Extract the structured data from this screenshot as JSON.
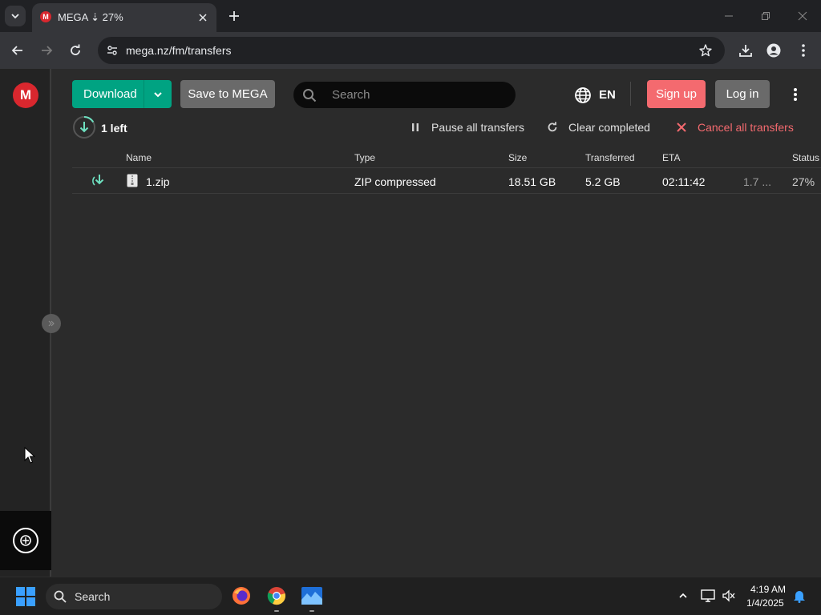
{
  "browser": {
    "tab_title": "MEGA ⇣ 27%",
    "favicon_letter": "M",
    "url": "mega.nz/fm/transfers"
  },
  "header": {
    "download_label": "Download",
    "save_to_mega_label": "Save to MEGA",
    "search_placeholder": "Search",
    "language": "EN",
    "signup_label": "Sign up",
    "login_label": "Log in",
    "logo_letter": "M"
  },
  "transfers": {
    "left_count": "1 left",
    "pause_all_label": "Pause all transfers",
    "clear_completed_label": "Clear completed",
    "cancel_all_label": "Cancel all transfers",
    "columns": {
      "name": "Name",
      "type": "Type",
      "size": "Size",
      "transferred": "Transferred",
      "eta": "ETA",
      "status": "Status"
    },
    "rows": [
      {
        "name": "1.zip",
        "type": "ZIP compressed",
        "size": "18.51 GB",
        "transferred": "5.2 GB",
        "eta": "02:11:42",
        "speed": "1.7 ...",
        "status": "27%"
      }
    ]
  },
  "taskbar": {
    "search_label": "Search",
    "time": "4:19 AM",
    "date": "1/4/2025"
  },
  "colors": {
    "download_green": "#00a382",
    "signup_red": "#f46a6f",
    "cancel_red": "#f46a6f",
    "mega_red": "#d9272e",
    "progress_teal": "#6ee0c0"
  }
}
